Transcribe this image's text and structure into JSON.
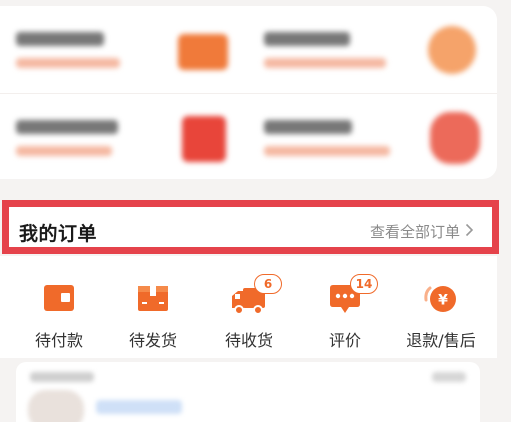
{
  "orders": {
    "title": "我的订单",
    "view_all": "查看全部订单"
  },
  "status_items": [
    {
      "label": "待付款",
      "icon": "wallet-icon",
      "badge": null
    },
    {
      "label": "待发货",
      "icon": "box-icon",
      "badge": null
    },
    {
      "label": "待收货",
      "icon": "truck-icon",
      "badge": "6"
    },
    {
      "label": "评价",
      "icon": "comment-icon",
      "badge": "14"
    },
    {
      "label": "退款/售后",
      "icon": "refund-icon",
      "badge": null
    }
  ],
  "colors": {
    "accent": "#f06a2a",
    "highlight_border": "#e5434b"
  }
}
